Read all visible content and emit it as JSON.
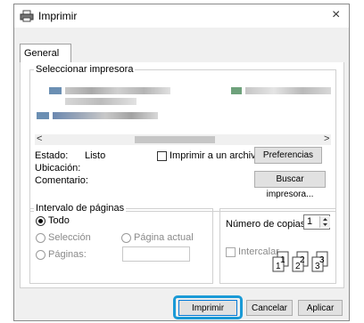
{
  "dialog": {
    "title": "Imprimir",
    "close_glyph": "×",
    "tab_general": "General"
  },
  "select_printer": {
    "legend": "Seleccionar impresora",
    "scroll_left": "<",
    "scroll_right": ">"
  },
  "status": {
    "estado_label": "Estado:",
    "estado_value": "Listo",
    "ubicacion_label": "Ubicación:",
    "comentario_label": "Comentario:",
    "print_to_file_label": "Imprimir a un archivo",
    "preferences_button": "Preferencias",
    "find_printer_button": "Buscar impresora..."
  },
  "page_range": {
    "legend": "Intervalo de páginas",
    "all_label": "Todo",
    "selection_label": "Selección",
    "current_page_label": "Página actual",
    "pages_label": "Páginas:"
  },
  "copies": {
    "label": "Número de copias:",
    "value": "1",
    "collate_label": "Intercalar"
  },
  "footer": {
    "print_button": "Imprimir",
    "cancel_button": "Cancelar",
    "apply_button": "Aplicar"
  },
  "icons": {
    "printer": "printer-icon",
    "close": "close-icon",
    "spin": "spinner-icon",
    "collate": "collate-pages-icon"
  },
  "colors": {
    "highlight_ring": "#1a9ad6",
    "default_button_border": "#0078d7"
  }
}
